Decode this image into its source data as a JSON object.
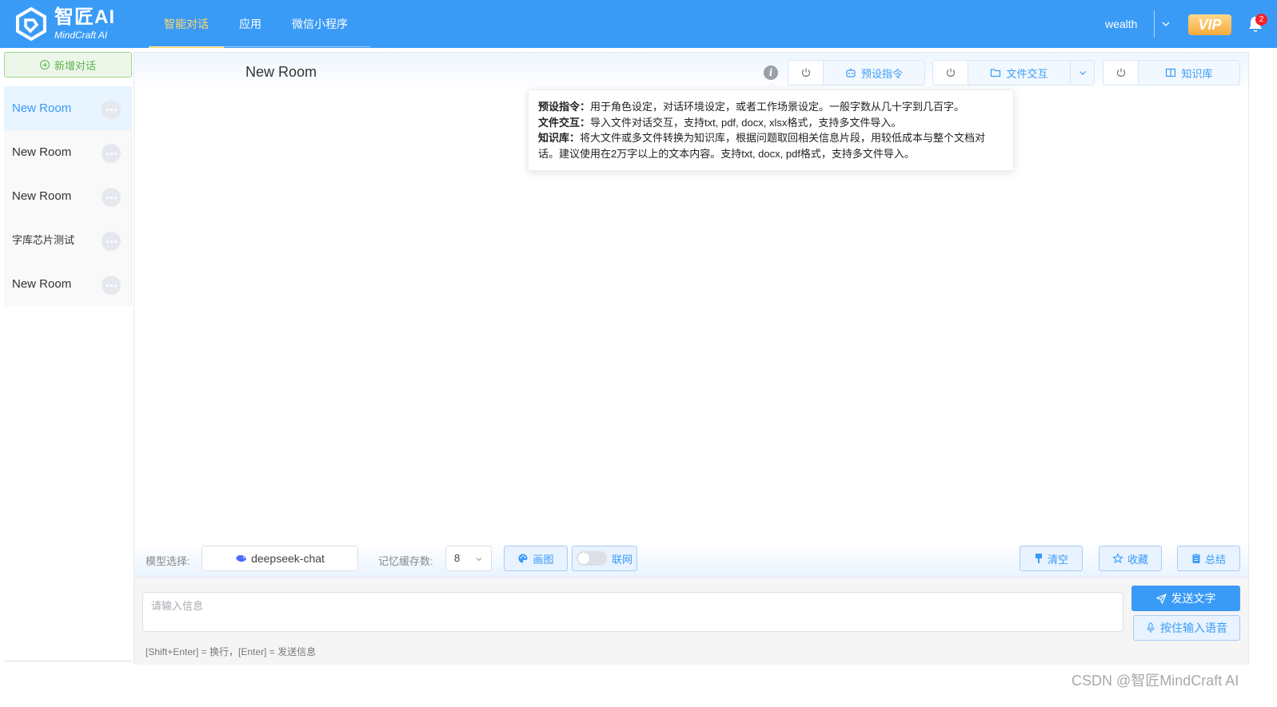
{
  "header": {
    "logo_cn": "智匠AI",
    "logo_en": "MindCraft  AI",
    "nav": [
      {
        "label": "智能对话",
        "active": true
      },
      {
        "label": "应用",
        "active": false
      },
      {
        "label": "微信小程序",
        "active": false
      }
    ],
    "username": "wealth",
    "vip_label": "VIP",
    "notification_count": "2"
  },
  "sidebar": {
    "new_chat_label": "新增对话",
    "rooms": [
      {
        "name": "New Room",
        "active": true
      },
      {
        "name": "New Room",
        "active": false
      },
      {
        "name": "New Room",
        "active": false
      },
      {
        "name": "字库芯片测试",
        "active": false
      },
      {
        "name": "New Room",
        "active": false
      }
    ]
  },
  "main": {
    "room_title": "New Room",
    "info_icon": "i",
    "tools": {
      "preset_label": "预设指令",
      "file_label": "文件交互",
      "kb_label": "知识库"
    },
    "tooltip": {
      "line1_key": "预设指令：",
      "line1_text": "用于角色设定，对话环境设定，或者工作场景设定。一般字数从几十字到几百字。",
      "line2_key": "文件交互：",
      "line2_text": "导入文件对话交互，支持txt, pdf, docx, xlsx格式，支持多文件导入。",
      "line3_key": "知识库：",
      "line3_text": "将大文件或多文件转换为知识库，根据问题取回相关信息片段，用较低成本与整个文档对话。建议使用在2万字以上的文本内容。支持txt, docx, pdf格式，支持多文件导入。"
    },
    "controls": {
      "model_label": "模型选择:",
      "model_value": "deepseek-chat",
      "memory_label": "记忆缓存数:",
      "memory_value": "8",
      "draw_label": "画图",
      "web_label": "联网",
      "clear_label": "清空",
      "favorite_label": "收藏",
      "summary_label": "总结"
    },
    "input": {
      "placeholder": "请输入信息",
      "send_label": "发送文字",
      "voice_label": "按住输入语音",
      "hint": "[Shift+Enter] = 换行，[Enter] = 发送信息"
    }
  },
  "watermark": "CSDN @智匠MindCraft AI",
  "colors": {
    "primary": "#3a9bf7",
    "nav_active": "#ffd66b",
    "new_chat_green": "#5cb24a",
    "badge_red": "#f5222d"
  }
}
